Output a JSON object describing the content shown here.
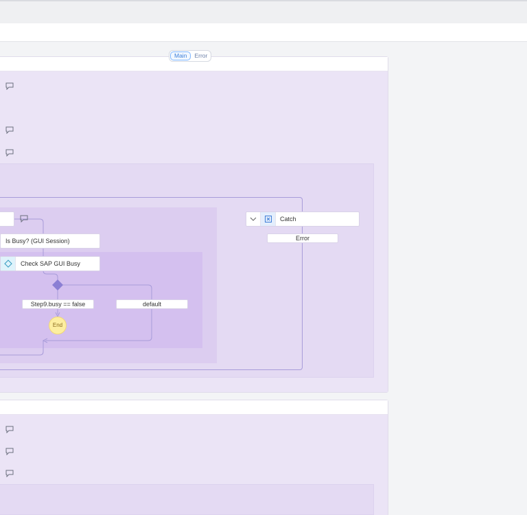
{
  "view_toggle": {
    "main_label": "Main",
    "error_label": "Error",
    "active": "Main"
  },
  "nodes": {
    "is_busy_label": "Is Busy? (GUI Session)",
    "check_busy_label": "Check SAP GUI Busy",
    "catch_label": "Catch",
    "catch_error_label": "Error",
    "condition_label": "Step9.busy == false",
    "default_label": "default",
    "end_label": "End"
  },
  "icons": {
    "comment": "comment-icon",
    "decision": "diamond-icon",
    "catch": "catch-icon",
    "collapse": "chevron-down-icon"
  },
  "colors": {
    "canvas_bg": "#f3f4f6",
    "flow_body": "#ebe4f6",
    "container_1": "#e4daf3",
    "container_2": "#dccdf0",
    "container_3": "#d4c0ef",
    "connector": "#a79bd9",
    "gateway": "#8b7fd4",
    "end_fill": "#fdeea0",
    "accent": "#3d7fd9"
  }
}
